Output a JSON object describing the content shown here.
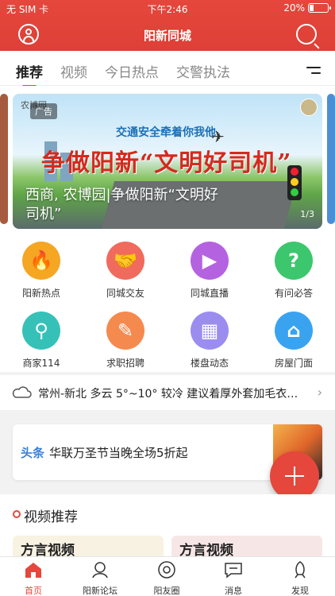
{
  "status_bar": {
    "carrier": "无 SIM 卡",
    "time": "下午2:46",
    "battery": "20%",
    "battery_level": 0.2
  },
  "header": {
    "title": "阳新同城"
  },
  "tabs": [
    {
      "label": "推荐",
      "active": true
    },
    {
      "label": "视频",
      "active": false
    },
    {
      "label": "今日热点",
      "active": false
    },
    {
      "label": "交警执法",
      "active": false
    }
  ],
  "banner": {
    "ad_tag": "广告",
    "logo_text": "农博园",
    "slogan": "交通安全牵着你我他",
    "headline": "争做阳新“文明好司机”",
    "caption": "西商, 农博园|争做阳新“文明好司机”",
    "pager": "1/3"
  },
  "shortcuts": [
    {
      "label": "阳新热点",
      "icon": "flame-icon",
      "color": "#f5a623"
    },
    {
      "label": "同城交友",
      "icon": "handshake-icon",
      "color": "#f06a5e"
    },
    {
      "label": "同城直播",
      "icon": "video-camera-icon",
      "color": "#b562e0"
    },
    {
      "label": "有问必答",
      "icon": "question-icon",
      "color": "#3cc66e"
    },
    {
      "label": "商家114",
      "icon": "search-icon",
      "color": "#36c1b8"
    },
    {
      "label": "求职招聘",
      "icon": "job-icon",
      "color": "#f58a4e"
    },
    {
      "label": "楼盘动态",
      "icon": "building-icon",
      "color": "#9b8df0"
    },
    {
      "label": "房屋门面",
      "icon": "storefront-icon",
      "color": "#3aa3f0"
    }
  ],
  "weather": {
    "text": "常州-新北  多云  5°~10°  较冷  建议着厚外套加毛衣…"
  },
  "headline_news": {
    "tag": "头条",
    "title": "华联万圣节当晚全场5折起"
  },
  "video_section": {
    "title": "视频推荐",
    "cards": [
      "方言视频",
      "方言视频"
    ]
  },
  "bottom_nav": [
    {
      "label": "首页",
      "icon": "home-icon",
      "active": true
    },
    {
      "label": "阳新论坛",
      "icon": "forum-icon",
      "active": false
    },
    {
      "label": "阳友圈",
      "icon": "circle-icon",
      "active": false
    },
    {
      "label": "消息",
      "icon": "message-icon",
      "active": false
    },
    {
      "label": "发现",
      "icon": "rocket-icon",
      "active": false
    }
  ],
  "colors": {
    "brand": "#e5473d",
    "accent_blue": "#3b7fd6"
  }
}
